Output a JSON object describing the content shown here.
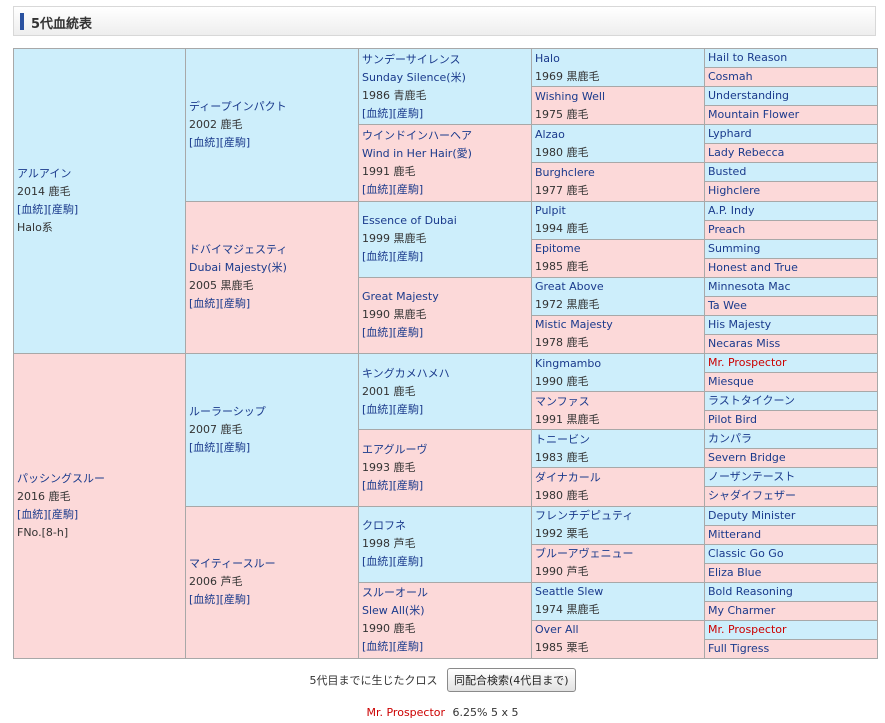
{
  "title": "5代血統表",
  "pedigree": {
    "g1": [
      {
        "name": "アルアイン",
        "line2": "2014 鹿毛",
        "links": "[血統][産駒]",
        "extra": "Halo系",
        "color": "b"
      },
      {
        "name": "パッシングスルー",
        "line2": "2016 鹿毛",
        "links": "[血統][産駒]",
        "extra": "FNo.[8-h]",
        "color": "r"
      }
    ],
    "g2": [
      {
        "name": "ディープインパクト",
        "line2": "2002 鹿毛",
        "links": "[血統][産駒]",
        "color": "b"
      },
      {
        "name": "ドバイマジェスティ",
        "name_en": "Dubai Majesty(米)",
        "line2": "2005 黒鹿毛",
        "links": "[血統][産駒]",
        "color": "r"
      },
      {
        "name": "ルーラーシップ",
        "line2": "2007 鹿毛",
        "links": "[血統][産駒]",
        "color": "b"
      },
      {
        "name": "マイティースルー",
        "line2": "2006 芦毛",
        "links": "[血統][産駒]",
        "color": "r"
      }
    ],
    "g3": [
      {
        "name": "サンデーサイレンス",
        "name_en": "Sunday Silence(米)",
        "line2": "1986 青鹿毛",
        "links": "[血統][産駒]",
        "color": "b"
      },
      {
        "name": "ウインドインハーヘア",
        "name_en": "Wind in Her Hair(愛)",
        "line2": "1991 鹿毛",
        "links": "[血統][産駒]",
        "color": "r"
      },
      {
        "name": "Essence of Dubai",
        "line2": "1999 黒鹿毛",
        "links": "[血統][産駒]",
        "color": "b"
      },
      {
        "name": "Great Majesty",
        "line2": "1990 黒鹿毛",
        "links": "[血統][産駒]",
        "color": "r"
      },
      {
        "name": "キングカメハメハ",
        "line2": "2001 鹿毛",
        "links": "[血統][産駒]",
        "color": "b"
      },
      {
        "name": "エアグルーヴ",
        "line2": "1993 鹿毛",
        "links": "[血統][産駒]",
        "color": "r"
      },
      {
        "name": "クロフネ",
        "line2": "1998 芦毛",
        "links": "[血統][産駒]",
        "color": "b"
      },
      {
        "name": "スルーオール",
        "name_en": "Slew All(米)",
        "line2": "1990 鹿毛",
        "links": "[血統][産駒]",
        "color": "r"
      }
    ],
    "g4": [
      {
        "name": "Halo",
        "line2": "1969 黒鹿毛",
        "color": "b"
      },
      {
        "name": "Wishing Well",
        "line2": "1975 鹿毛",
        "color": "r"
      },
      {
        "name": "Alzao",
        "line2": "1980 鹿毛",
        "color": "b"
      },
      {
        "name": "Burghclere",
        "line2": "1977 鹿毛",
        "color": "r"
      },
      {
        "name": "Pulpit",
        "line2": "1994 鹿毛",
        "color": "b"
      },
      {
        "name": "Epitome",
        "line2": "1985 鹿毛",
        "color": "r"
      },
      {
        "name": "Great Above",
        "line2": "1972 黒鹿毛",
        "color": "b"
      },
      {
        "name": "Mistic Majesty",
        "line2": "1978 鹿毛",
        "color": "r"
      },
      {
        "name": "Kingmambo",
        "line2": "1990 鹿毛",
        "color": "b"
      },
      {
        "name": "マンファス",
        "line2": "1991 黒鹿毛",
        "color": "r"
      },
      {
        "name": "トニービン",
        "line2": "1983 鹿毛",
        "color": "b"
      },
      {
        "name": "ダイナカール",
        "line2": "1980 鹿毛",
        "color": "r"
      },
      {
        "name": "フレンチデピュティ",
        "line2": "1992 栗毛",
        "color": "b"
      },
      {
        "name": "ブルーアヴェニュー",
        "line2": "1990 芦毛",
        "color": "r"
      },
      {
        "name": "Seattle Slew",
        "line2": "1974 黒鹿毛",
        "color": "b"
      },
      {
        "name": "Over All",
        "line2": "1985 栗毛",
        "color": "r"
      }
    ],
    "g5": [
      {
        "name": "Hail to Reason",
        "color": "b"
      },
      {
        "name": "Cosmah",
        "color": "r"
      },
      {
        "name": "Understanding",
        "color": "b"
      },
      {
        "name": "Mountain Flower",
        "color": "r"
      },
      {
        "name": "Lyphard",
        "color": "b"
      },
      {
        "name": "Lady Rebecca",
        "color": "r"
      },
      {
        "name": "Busted",
        "color": "b"
      },
      {
        "name": "Highclere",
        "color": "r"
      },
      {
        "name": "A.P. Indy",
        "color": "b"
      },
      {
        "name": "Preach",
        "color": "r"
      },
      {
        "name": "Summing",
        "color": "b"
      },
      {
        "name": "Honest and True",
        "color": "r"
      },
      {
        "name": "Minnesota Mac",
        "color": "b"
      },
      {
        "name": "Ta Wee",
        "color": "r"
      },
      {
        "name": "His Majesty",
        "color": "b"
      },
      {
        "name": "Necaras Miss",
        "color": "r"
      },
      {
        "name": "Mr. Prospector",
        "color": "b",
        "highlight": true
      },
      {
        "name": "Miesque",
        "color": "r"
      },
      {
        "name": "ラストタイクーン",
        "color": "b"
      },
      {
        "name": "Pilot Bird",
        "color": "r"
      },
      {
        "name": "カンパラ",
        "color": "b"
      },
      {
        "name": "Severn Bridge",
        "color": "r"
      },
      {
        "name": "ノーザンテースト",
        "color": "b"
      },
      {
        "name": "シャダイフェザー",
        "color": "r"
      },
      {
        "name": "Deputy Minister",
        "color": "b"
      },
      {
        "name": "Mitterand",
        "color": "r"
      },
      {
        "name": "Classic Go Go",
        "color": "b"
      },
      {
        "name": "Eliza Blue",
        "color": "r"
      },
      {
        "name": "Bold Reasoning",
        "color": "b"
      },
      {
        "name": "My Charmer",
        "color": "r"
      },
      {
        "name": "Mr. Prospector",
        "color": "b",
        "highlight": true
      },
      {
        "name": "Full Tigress",
        "color": "r"
      }
    ]
  },
  "cross": {
    "label": "5代目までに生じたクロス",
    "button": "同配合検索(4代目まで)",
    "horse": "Mr. Prospector",
    "pct": "6.25%  5 x 5"
  }
}
